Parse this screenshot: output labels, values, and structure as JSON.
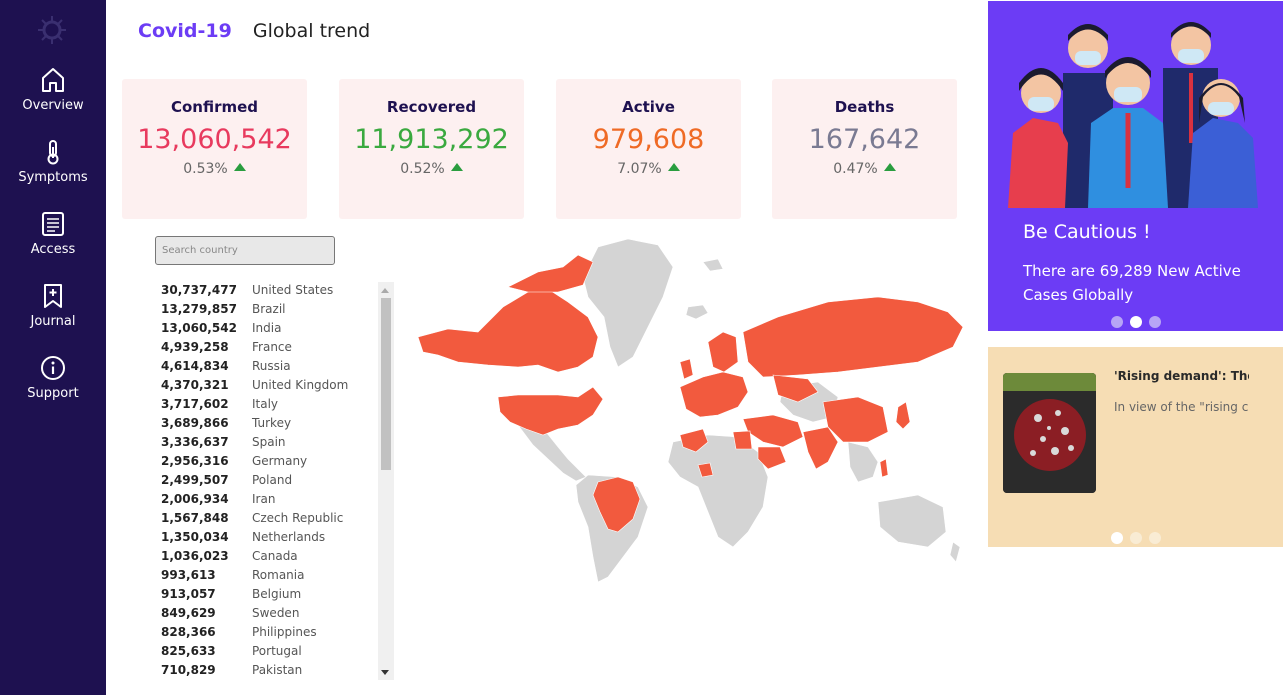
{
  "nav": {
    "items": [
      {
        "label": "Overview",
        "icon": "home-icon"
      },
      {
        "label": "Symptoms",
        "icon": "thermometer-icon"
      },
      {
        "label": "Access",
        "icon": "document-icon"
      },
      {
        "label": "Journal",
        "icon": "bookmark-icon"
      },
      {
        "label": "Support",
        "icon": "info-icon"
      }
    ]
  },
  "header": {
    "brand": "Covid-19",
    "subtitle": "Global trend"
  },
  "stats": [
    {
      "title": "Confirmed",
      "value": "13,060,542",
      "change": "0.53%",
      "color": "#e83a5e"
    },
    {
      "title": "Recovered",
      "value": "11,913,292",
      "change": "0.52%",
      "color": "#3aa93f"
    },
    {
      "title": "Active",
      "value": "979,608",
      "change": "7.07%",
      "color": "#ef6a25"
    },
    {
      "title": "Deaths",
      "value": "167,642",
      "change": "0.47%",
      "color": "#7a7a92"
    }
  ],
  "search": {
    "placeholder": "Search country"
  },
  "countries": [
    {
      "cases": "30,737,477",
      "name": "United States"
    },
    {
      "cases": "13,279,857",
      "name": "Brazil"
    },
    {
      "cases": "13,060,542",
      "name": "India"
    },
    {
      "cases": "4,939,258",
      "name": "France"
    },
    {
      "cases": "4,614,834",
      "name": "Russia"
    },
    {
      "cases": "4,370,321",
      "name": "United Kingdom"
    },
    {
      "cases": "3,717,602",
      "name": "Italy"
    },
    {
      "cases": "3,689,866",
      "name": "Turkey"
    },
    {
      "cases": "3,336,637",
      "name": "Spain"
    },
    {
      "cases": "2,956,316",
      "name": "Germany"
    },
    {
      "cases": "2,499,507",
      "name": "Poland"
    },
    {
      "cases": "2,006,934",
      "name": "Iran"
    },
    {
      "cases": "1,567,848",
      "name": "Czech Republic"
    },
    {
      "cases": "1,350,034",
      "name": "Netherlands"
    },
    {
      "cases": "1,036,023",
      "name": "Canada"
    },
    {
      "cases": "993,613",
      "name": "Romania"
    },
    {
      "cases": "913,057",
      "name": "Belgium"
    },
    {
      "cases": "849,629",
      "name": "Sweden"
    },
    {
      "cases": "828,366",
      "name": "Philippines"
    },
    {
      "cases": "825,633",
      "name": "Portugal"
    },
    {
      "cases": "710,829",
      "name": "Pakistan"
    }
  ],
  "map": {
    "highlight_color": "#f25a3e",
    "base_color": "#d4d4d4"
  },
  "promo": {
    "title": "Be Cautious !",
    "text": "There are 69,289 New Active Cases Globally",
    "accent": "#6c3cf5",
    "active_slide": 2,
    "slides": 3
  },
  "news": {
    "title": "'Rising demand': Tho",
    "text": "In view of the \"rising c",
    "active_slide": 1,
    "slides": 3
  }
}
